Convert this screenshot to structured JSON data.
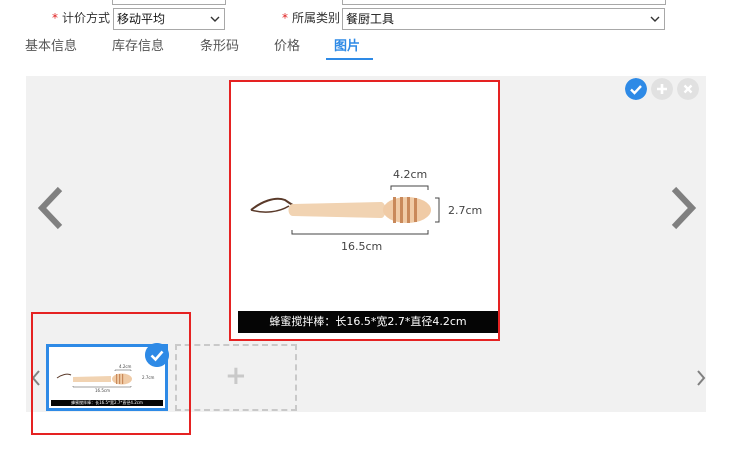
{
  "form": {
    "pricing": {
      "label": "计价方式",
      "required_mark": "*",
      "value": "移动平均"
    },
    "category": {
      "label": "所属类别",
      "required_mark": "*",
      "value": "餐厨工具"
    }
  },
  "tabs": [
    {
      "label": "基本信息",
      "active": false
    },
    {
      "label": "库存信息",
      "active": false
    },
    {
      "label": "条形码",
      "active": false
    },
    {
      "label": "价格",
      "active": false
    },
    {
      "label": "图片",
      "active": true
    }
  ],
  "viewer": {
    "image": {
      "dim_width": "4.2cm",
      "dim_height": "2.7cm",
      "dim_length": "16.5cm",
      "caption": "蜂蜜搅拌棒：长16.5*宽2.7*直径4.2cm"
    },
    "thumbnail": {
      "dim_width": "4.2cm",
      "dim_height": "2.7cm",
      "dim_length": "16.5cm",
      "caption": "蜂蜜搅拌棒：长16.5*宽2.7*直径4.2cm",
      "selected": true
    },
    "add_slot_symbol": "+"
  },
  "colors": {
    "accent": "#2e8ae6",
    "highlight_border": "#e52222",
    "viewer_bg": "#f1f1f1"
  }
}
